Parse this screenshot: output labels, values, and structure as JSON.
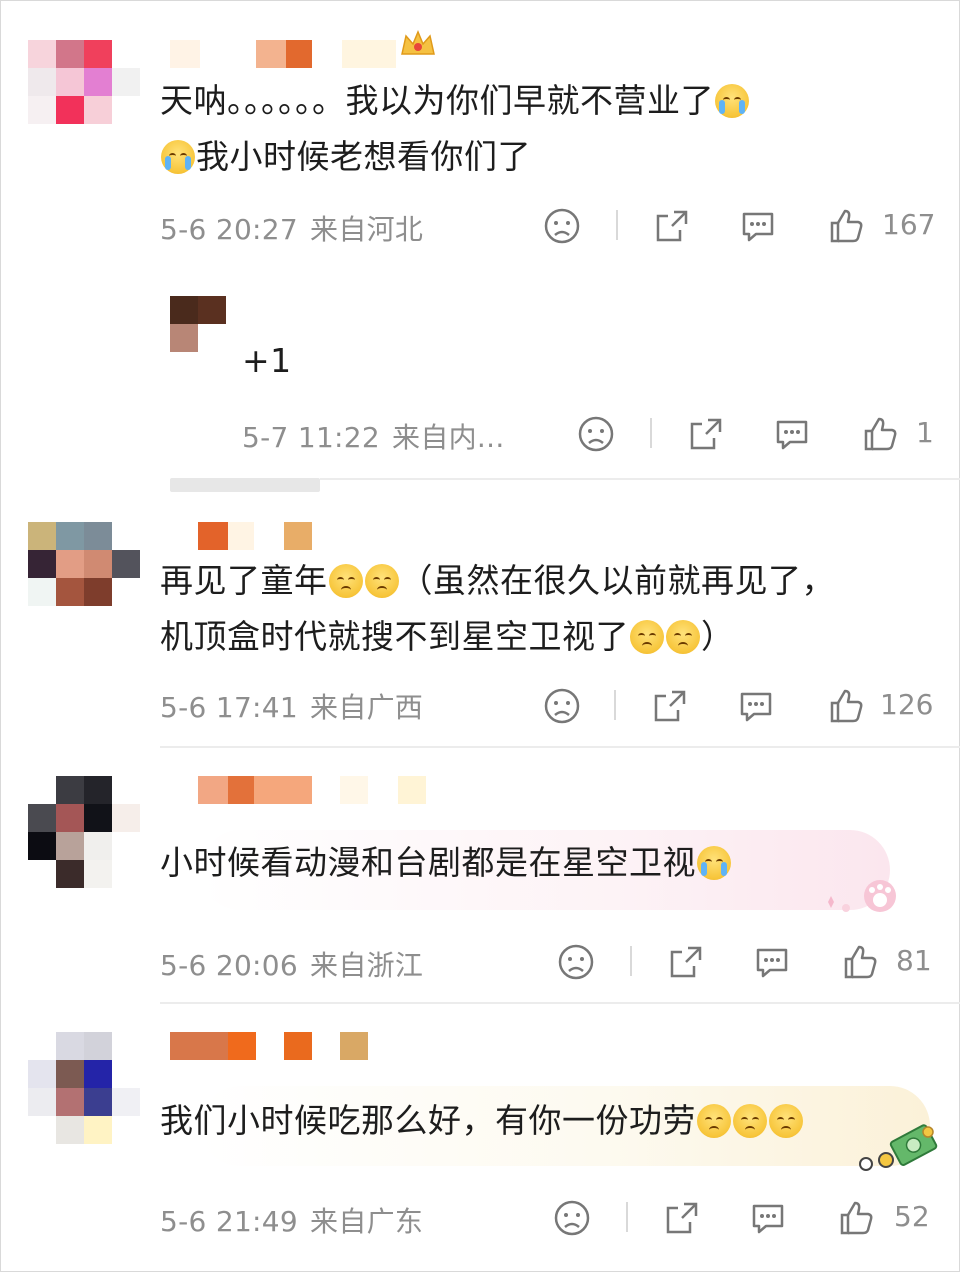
{
  "comments": [
    {
      "text_line1": "天呐。。。。。。我以为你们早就不营业了",
      "text_line2": "我小时候老想看你们了",
      "time": "5-6 20:27",
      "location": "来自河北",
      "likes": "167"
    },
    {
      "text_line1": "+1",
      "time": "5-7 11:22",
      "location": "来自内...",
      "likes": "1"
    },
    {
      "text_line1": "再见了童年",
      "text_line1b": "（虽然在很久以前就再见了，",
      "text_line2": "机顶盒时代就搜不到星空卫视了",
      "text_line2b": "）",
      "time": "5-6 17:41",
      "location": "来自广西",
      "likes": "126"
    },
    {
      "text_line1": "小时候看动漫和台剧都是在星空卫视",
      "time": "5-6 20:06",
      "location": "来自浙江",
      "likes": "81"
    },
    {
      "text_line1": "我们小时候吃那么好，有你一份功劳",
      "time": "5-6 21:49",
      "location": "来自广东",
      "likes": "52"
    }
  ],
  "icons": {
    "dislike": "sad-face-icon",
    "share": "share-icon",
    "reply": "comment-bubble-icon",
    "like": "thumbs-up-icon"
  },
  "colors": {
    "text": "#1d1d1d",
    "meta": "#8e8e8e",
    "separator": "#ececec"
  }
}
